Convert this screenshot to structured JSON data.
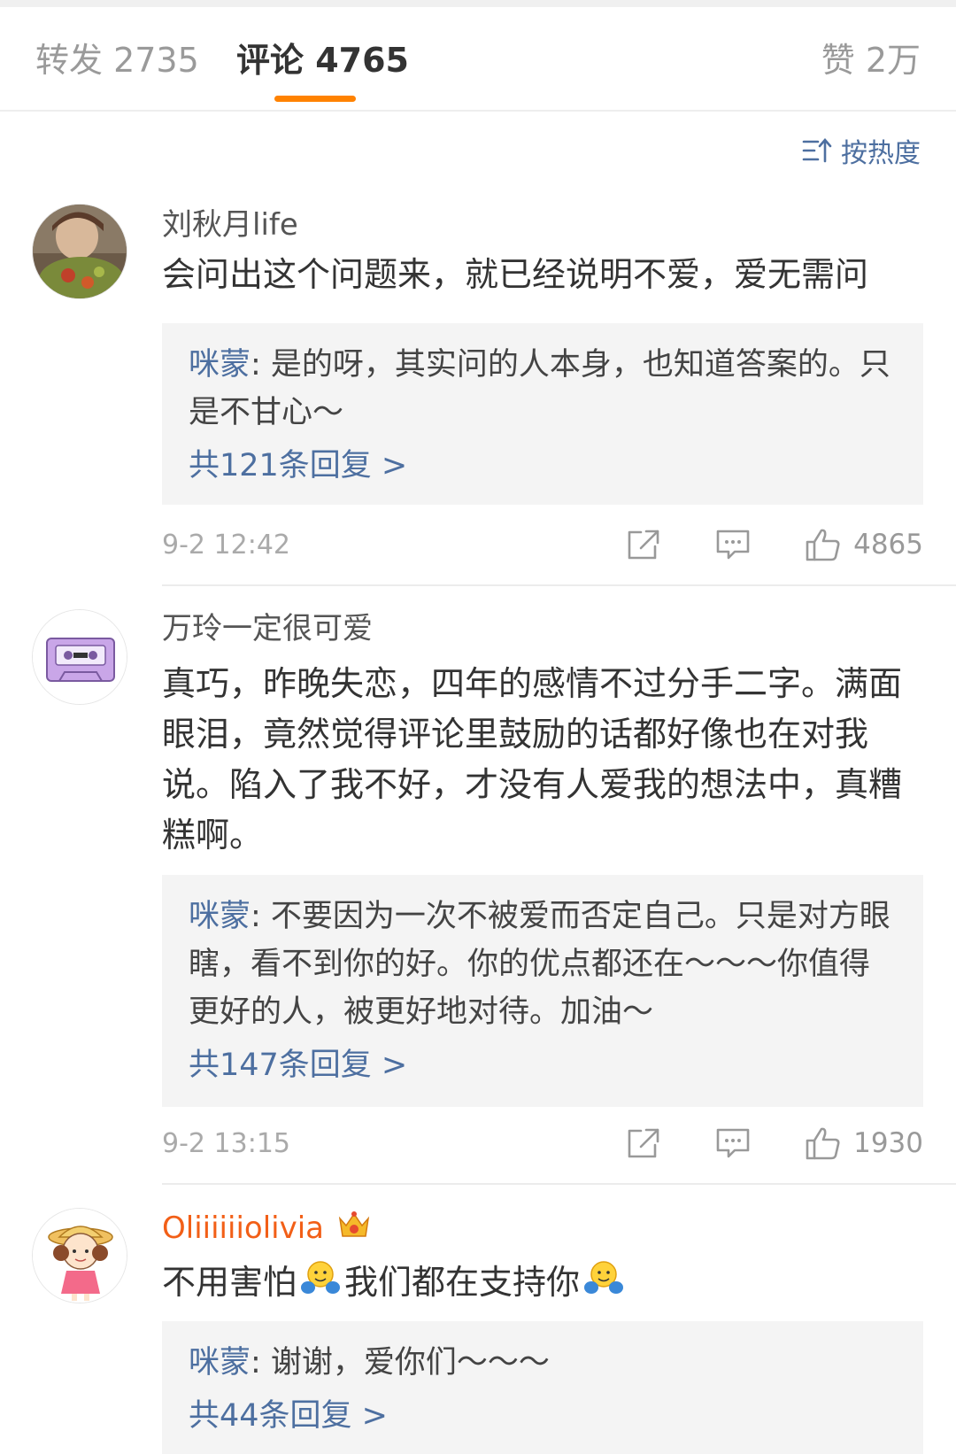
{
  "tabs": {
    "repost": "转发 2735",
    "comments": "评论 4765",
    "likes": "赞 2万"
  },
  "sort": {
    "label": "按热度",
    "icon": "sort-icon"
  },
  "comments": [
    {
      "user": "刘秋月life",
      "text": "会问出这个问题来，就已经说明不爱，爱无需问",
      "reply_author": "咪蒙",
      "reply_text": ": 是的呀，其实问的人本身，也知道答案的。只是不甘心～",
      "reply_more": "共121条回复 >",
      "time": "9-2 12:42",
      "likes": "4865"
    },
    {
      "user": "万玲一定很可爱",
      "text": "真巧，昨晚失恋，四年的感情不过分手二字。满面眼泪，竟然觉得评论里鼓励的话都好像也在对我说。陷入了我不好，才没有人爱我的想法中，真糟糕啊。",
      "reply_author": "咪蒙",
      "reply_text": ": 不要因为一次不被爱而否定自己。只是对方眼瞎，看不到你的好。你的优点都还在～～～你值得更好的人，被更好地对待。加油～",
      "reply_more": "共147条回复 >",
      "time": "9-2 13:15",
      "likes": "1930"
    },
    {
      "user": "Oliiiiiiolivia",
      "text_part1": "不用害怕",
      "text_part2": "我们都在支持你",
      "reply_author": "咪蒙",
      "reply_text": ": 谢谢，爱你们～～～",
      "reply_more": "共44条回复 >"
    }
  ],
  "colors": {
    "accent": "#ff8200",
    "link": "#4d6fa0",
    "vip_name": "#f25f17"
  }
}
